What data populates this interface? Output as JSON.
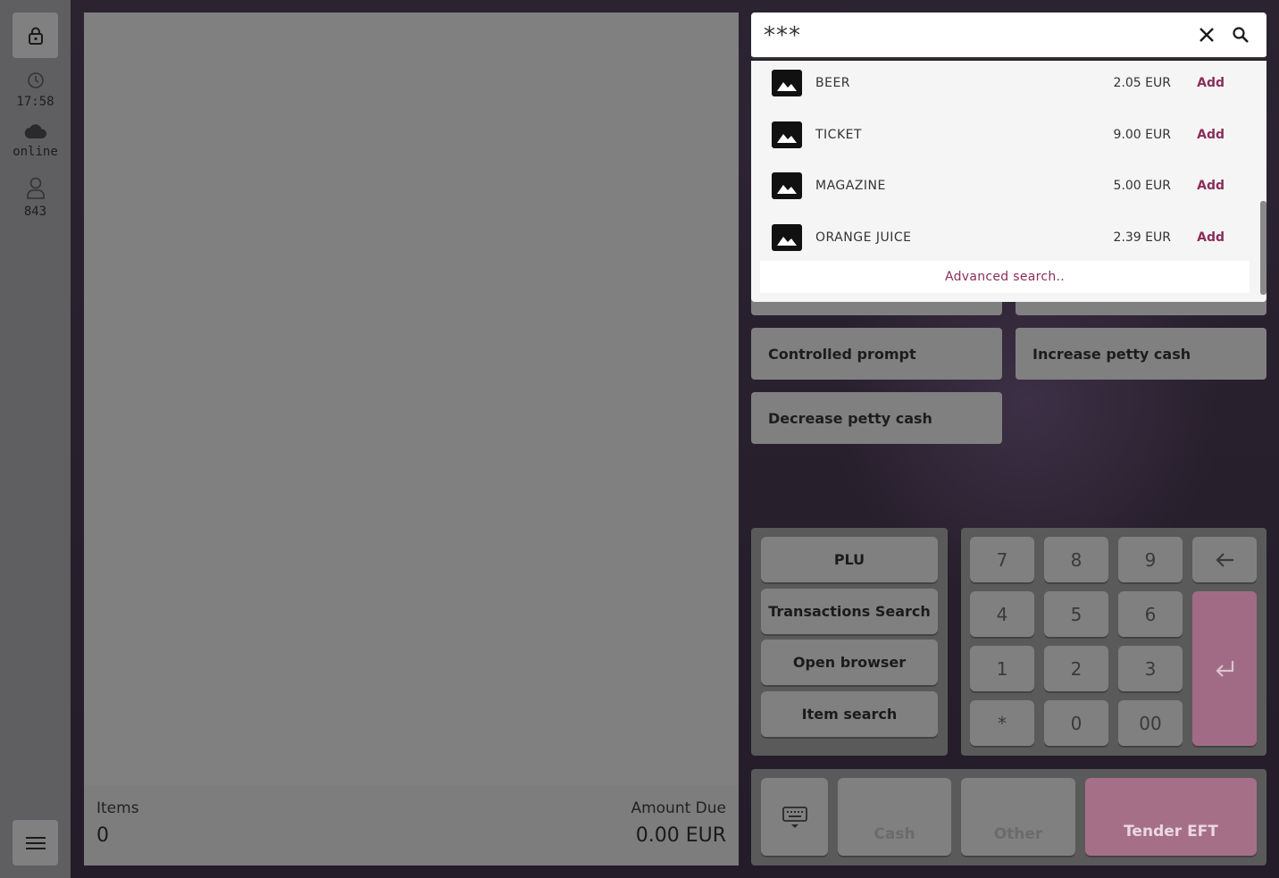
{
  "rail": {
    "clock": "17:58",
    "status": "online",
    "user": "843"
  },
  "receipt": {
    "items_label": "Items",
    "items_value": "0",
    "due_label": "Amount Due",
    "due_value": "0.00 EUR"
  },
  "search": {
    "value": "***",
    "results": [
      {
        "name": "BEER",
        "price": "2.05 EUR",
        "action": "Add"
      },
      {
        "name": "TICKET",
        "price": "9.00 EUR",
        "action": "Add"
      },
      {
        "name": "MAGAZINE",
        "price": "5.00 EUR",
        "action": "Add"
      },
      {
        "name": "ORANGE JUICE",
        "price": "2.39 EUR",
        "action": "Add"
      }
    ],
    "advanced": "Advanced search.."
  },
  "functions": {
    "controlled_prompt": "Controlled prompt",
    "increase_petty_cash": "Increase petty cash",
    "decrease_petty_cash": "Decrease petty cash"
  },
  "shortcuts": {
    "plu": "PLU",
    "transactions_search": "Transactions Search",
    "open_browser": "Open browser",
    "item_search": "Item search"
  },
  "keypad": {
    "k7": "7",
    "k8": "8",
    "k9": "9",
    "k4": "4",
    "k5": "5",
    "k6": "6",
    "k1": "1",
    "k2": "2",
    "k3": "3",
    "kstar": "*",
    "k0": "0",
    "k00": "00"
  },
  "payment": {
    "cash": "Cash",
    "other": "Other",
    "tender": "Tender EFT"
  },
  "colors": {
    "accent": "#8a2d5d",
    "enter": "#a26b85",
    "tender": "#a66f88"
  }
}
